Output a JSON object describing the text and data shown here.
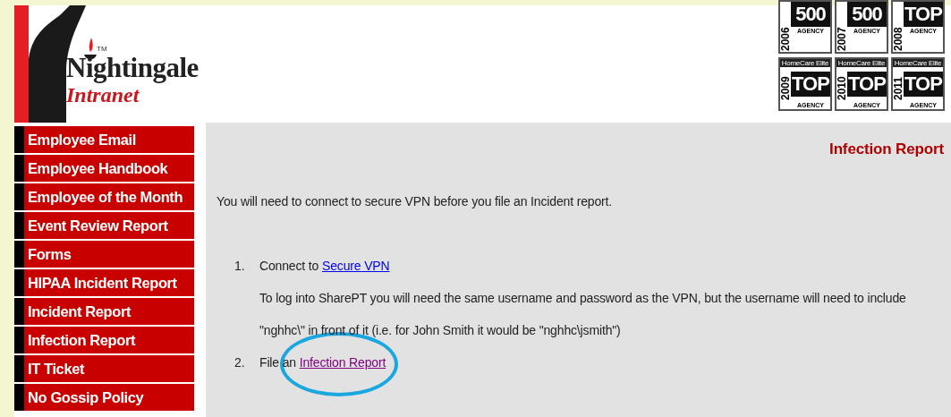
{
  "logo": {
    "trademark": "TM",
    "name": "Nightingale",
    "subtitle": "Intranet"
  },
  "badges": [
    {
      "year": "2006",
      "main": "500",
      "footer": "AGENCY"
    },
    {
      "year": "2007",
      "main": "500",
      "footer": "AGENCY"
    },
    {
      "year": "2008",
      "main": "TOP",
      "footer": "AGENCY"
    },
    {
      "year": "2009",
      "main": "TOP",
      "footer": "AGENCY",
      "heading": "HomeCare Elite"
    },
    {
      "year": "2010",
      "main": "TOP",
      "footer": "AGENCY",
      "heading": "HomeCare Elite"
    },
    {
      "year": "2011",
      "main": "TOP",
      "footer": "AGENCY",
      "heading": "HomeCare Elite"
    }
  ],
  "sidebar": {
    "items": [
      "Employee Email",
      "Employee Handbook",
      "Employee of the Month",
      "Event Review Report",
      "Forms",
      "HIPAA Incident Report",
      "Incident Report",
      "Infection Report",
      "IT Ticket",
      "No Gossip Policy"
    ]
  },
  "page_title": "Infection Report",
  "intro": "You will need to connect to secure VPN before you file an Incident report.",
  "steps": [
    {
      "number": "1.",
      "text": "Connect to ",
      "link": "Secure VPN",
      "visited": false,
      "note": "To log into SharePT you will need the same username and password as the VPN, but the username will need to include \"nghhc\\\" in front of it (i.e. for John Smith it would be \"nghhc\\jsmith\")"
    },
    {
      "number": "2.",
      "text": "File an ",
      "link": "Infection Report",
      "visited": true,
      "circled": true
    }
  ]
}
